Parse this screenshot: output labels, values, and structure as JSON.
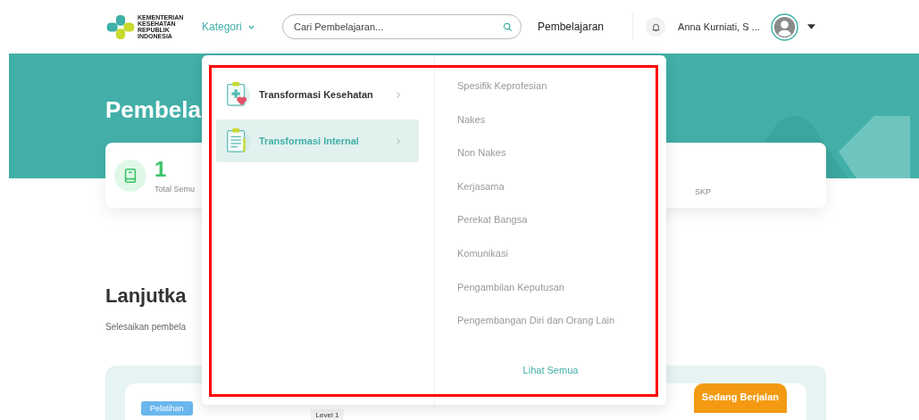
{
  "header": {
    "logo_text": [
      "KEMENTERIAN",
      "KESEHATAN",
      "REPUBLIK",
      "INDONESIA"
    ],
    "category_menu": {
      "label": "Kategori",
      "expanded": true
    },
    "search": {
      "placeholder": "Cari Pembelajaran..."
    },
    "nav_link": "Pembelajaran",
    "user_name": "Anna Kurniati, S ..."
  },
  "banner": {
    "title": "Pembela"
  },
  "stats_card": {
    "count": "1",
    "label": "Total Semu",
    "label_2": "SKP"
  },
  "section": {
    "title": "Lanjutka",
    "subtitle": "Selesaikan pembela"
  },
  "course_card": {
    "type_badge": "Pelatihan",
    "level": "Level 1",
    "status_badge": "Sedang Berjalan"
  },
  "dropdown": {
    "categories": [
      {
        "label": "Transformasi Kesehatan",
        "selected": false,
        "kind": "health"
      },
      {
        "label": "Transformasi Internal",
        "selected": true,
        "kind": "document"
      }
    ],
    "subcategories": [
      "Spesifik Keprofesian",
      "Nakes",
      "Non Nakes",
      "Kerjasama",
      "Perekat Bangsa",
      "Komunikasi",
      "Pengambilan Keputusan",
      "Pengembangan Diri dan Orang Lain"
    ],
    "see_all": "Lihat Semua"
  },
  "highlight": {
    "shown": true
  }
}
